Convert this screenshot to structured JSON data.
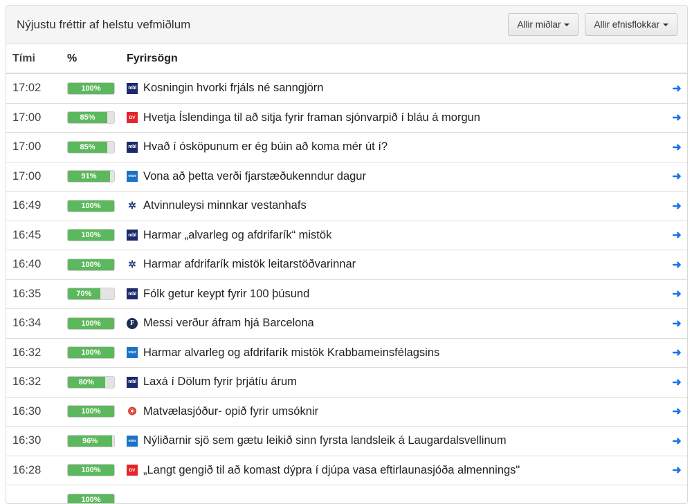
{
  "header": {
    "title": "Nýjustu fréttir af helstu vefmiðlum",
    "media_filter_label": "Allir miðlar",
    "category_filter_label": "Allir efnisflokkar"
  },
  "table": {
    "columns": {
      "time": "Tími",
      "percent": "%",
      "headline": "Fyrirsögn"
    },
    "rows": [
      {
        "time": "17:02",
        "percent_label": "100%",
        "percent": 100,
        "source": "mbl",
        "source_icon": "mbl-icon",
        "headline": "Kosningin hvorki frjáls né sanngjörn"
      },
      {
        "time": "17:00",
        "percent_label": "85%",
        "percent": 85,
        "source": "dv",
        "source_icon": "dv-icon",
        "headline": "Hvetja Íslendinga til að sitja fyrir framan sjónvarpið í bláu á morgun"
      },
      {
        "time": "17:00",
        "percent_label": "85%",
        "percent": 85,
        "source": "mbl",
        "source_icon": "mbl-icon",
        "headline": "Hvað í ósköpunum er ég búin að koma mér út í?"
      },
      {
        "time": "17:00",
        "percent_label": "91%",
        "percent": 91,
        "source": "visir",
        "source_icon": "visir-icon",
        "headline": "Vona að þetta verði fjarstæðukenndur dagur"
      },
      {
        "time": "16:49",
        "percent_label": "100%",
        "percent": 100,
        "source": "ruv",
        "source_icon": "ruv-icon",
        "headline": "Atvinnuleysi minnkar vestanhafs"
      },
      {
        "time": "16:45",
        "percent_label": "100%",
        "percent": 100,
        "source": "mbl",
        "source_icon": "mbl-icon",
        "headline": "Harmar „alvarleg og afdrifarík“ mistök"
      },
      {
        "time": "16:40",
        "percent_label": "100%",
        "percent": 100,
        "source": "ruv",
        "source_icon": "ruv-icon",
        "headline": "Harmar afdrifarík mistök leitarstöðvarinnar"
      },
      {
        "time": "16:35",
        "percent_label": "70%",
        "percent": 70,
        "source": "mbl",
        "source_icon": "mbl-icon",
        "headline": "Fólk getur keypt fyrir 100 þúsund"
      },
      {
        "time": "16:34",
        "percent_label": "100%",
        "percent": 100,
        "source": "frettabladid",
        "source_icon": "frettabladid-icon",
        "headline": "Messi verður áfram hjá Barcelona"
      },
      {
        "time": "16:32",
        "percent_label": "100%",
        "percent": 100,
        "source": "visir",
        "source_icon": "visir-icon",
        "headline": "Harmar alvarleg og afdrifarík mistök Krabbameinsfélagsins"
      },
      {
        "time": "16:32",
        "percent_label": "80%",
        "percent": 80,
        "source": "mbl",
        "source_icon": "mbl-icon",
        "headline": "Laxá í Dölum fyrir þrjátíu árum"
      },
      {
        "time": "16:30",
        "percent_label": "100%",
        "percent": 100,
        "source": "kjarninn",
        "source_icon": "kjarninn-icon",
        "headline": "Matvælasjóður- opið fyrir umsóknir"
      },
      {
        "time": "16:30",
        "percent_label": "96%",
        "percent": 96,
        "source": "visir",
        "source_icon": "visir-icon",
        "headline": "Nýliðarnir sjö sem gætu leikið sinn fyrsta landsleik á Laugardalsvellinum"
      },
      {
        "time": "16:28",
        "percent_label": "100%",
        "percent": 100,
        "source": "dv",
        "source_icon": "dv-icon",
        "headline": "„Langt gengið til að komast dýpra í djúpa vasa eftirlaunasjóða almennings\""
      },
      {
        "time": "",
        "percent_label": "100%",
        "percent": 100,
        "source": "",
        "source_icon": "",
        "headline": ""
      }
    ]
  },
  "source_glyphs": {
    "mbl": "mbl",
    "dv": "DV",
    "visir": "vísir",
    "ruv": "✲",
    "frettabladid": "F",
    "kjarninn": "❂"
  },
  "colors": {
    "progress": "#5cb85c",
    "arrow": "#1a73e8",
    "dv": "#e3262c",
    "mbl": "#1b2a6b",
    "visir": "#1a73c6"
  }
}
